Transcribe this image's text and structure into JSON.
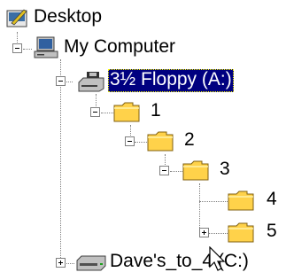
{
  "tree": {
    "root": {
      "label": "Desktop",
      "icon": "desktop-icon"
    },
    "my_computer": {
      "label": "My Computer",
      "icon": "computer-icon"
    },
    "floppy": {
      "label": "3½ Floppy (A:)",
      "icon": "floppy-drive-icon",
      "selected": true
    },
    "folders": [
      {
        "label": "1",
        "icon": "folder-icon"
      },
      {
        "label": "2",
        "icon": "folder-icon"
      },
      {
        "label": "3",
        "icon": "folder-icon"
      },
      {
        "label": "4",
        "icon": "folder-icon"
      },
      {
        "label": "5",
        "icon": "folder-icon"
      }
    ],
    "drive_c": {
      "label": "Dave's_to_4 (C:)",
      "icon": "hard-drive-icon"
    }
  },
  "colors": {
    "selection_bg": "#000080",
    "selection_text": "#ffffff",
    "folder": "#ffd24a",
    "tree_line": "#808080"
  }
}
